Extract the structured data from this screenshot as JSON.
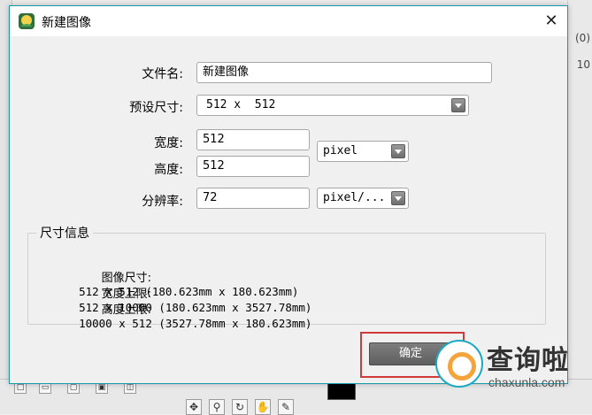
{
  "dialog": {
    "title": "新建图像",
    "close": "✕"
  },
  "form": {
    "filename_label": "文件名:",
    "filename_value": "新建图像",
    "preset_label": "预设尺寸:",
    "preset_value": "512 x  512",
    "width_label": "宽度:",
    "width_value": "512",
    "height_label": "高度:",
    "height_value": "512",
    "unit_value": "pixel",
    "resolution_label": "分辨率:",
    "resolution_value": "72",
    "resolution_unit": "pixel/..."
  },
  "size_info": {
    "title": "尺寸信息",
    "rows": [
      {
        "key": "图像尺寸:",
        "value": "512 x 512 (180.623mm x 180.623mm)"
      },
      {
        "key": "宽度上限:",
        "value": "512 x 10000 (180.623mm x 3527.78mm)"
      },
      {
        "key": "高度上限:",
        "value": "10000 x 512 (3527.78mm x 180.623mm)"
      }
    ]
  },
  "buttons": {
    "ok": "确定"
  },
  "background": {
    "right_texts": [
      "(0)",
      "10"
    ]
  },
  "watermark": {
    "cn": "查询啦",
    "en": "chaxunla.com"
  },
  "colors": {
    "dialog_border": "#1a9aa9",
    "highlight": "#d03a3a",
    "ok_button": "#6f6f6f"
  }
}
